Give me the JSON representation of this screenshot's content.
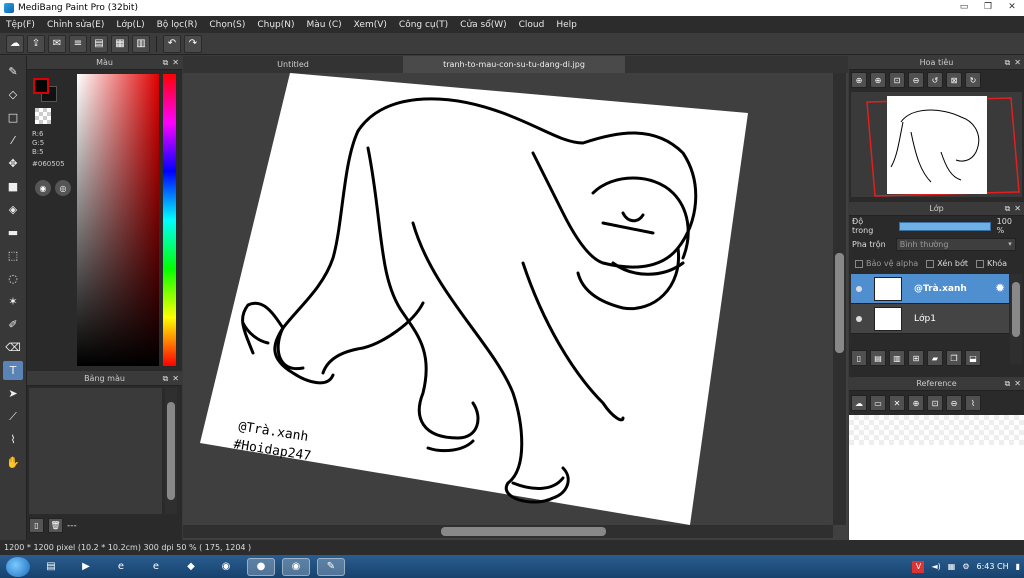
{
  "window": {
    "title": "MediBang Paint Pro (32bit)",
    "minimize": "▭",
    "restore": "❐",
    "close": "✕"
  },
  "menu": [
    "Tệp(F)",
    "Chỉnh sửa(E)",
    "Lớp(L)",
    "Bộ lọc(R)",
    "Chọn(S)",
    "Chụp(N)",
    "Màu (C)",
    "Xem(V)",
    "Công cụ(T)",
    "Cửa sổ(W)",
    "Cloud",
    "Help"
  ],
  "color_panel": {
    "title": "Màu",
    "rgb_r": "R:6",
    "rgb_g": "G:5",
    "rgb_b": "B:5",
    "hex": "#060505",
    "fg_color": "#060505"
  },
  "palette_panel": {
    "title": "Bảng màu",
    "footer_text": "---"
  },
  "tabs": {
    "untitled": "Untitled",
    "active": "tranh-to-mau-con-su-tu-dang-di.jpg"
  },
  "canvas": {
    "watermark_line1": "@Trà.xanh",
    "watermark_line2": "#Hoidap247"
  },
  "navigator": {
    "title": "Hoa tiêu"
  },
  "layers": {
    "title": "Lớp",
    "opacity_label": "Độ trong",
    "opacity_value": "100 %",
    "opacity": 1.0,
    "blend_label": "Pha trộn",
    "blend_value": "Bình thường",
    "protect_alpha": "Bảo vệ alpha",
    "clipping": "Xén bớt",
    "lock": "Khóa",
    "items": [
      {
        "name": "@Trà.xanh",
        "selected": true
      },
      {
        "name": "Lớp1",
        "selected": false
      }
    ]
  },
  "reference": {
    "title": "Reference"
  },
  "status": {
    "text": "1200 * 1200 pixel   (10.2 * 10.2cm)   300 dpi   50 %   ( 175, 1204 )"
  },
  "taskbar": {
    "clock": "6:43 CH",
    "tray_v": "V"
  },
  "colors": {
    "accent": "#4f8fcf",
    "panel_bg": "#2a2a2a",
    "opacity_bar": "#6fb1e6"
  }
}
